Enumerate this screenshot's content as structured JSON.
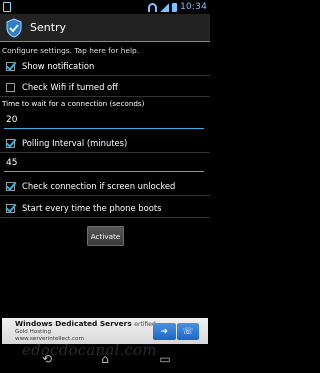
{
  "status_bar": {
    "time": "10:34"
  },
  "action_bar": {
    "title": "Sentry"
  },
  "hint": "Configure settings. Tap here for help.",
  "settings": {
    "show_notification": {
      "label": "Show notification",
      "checked": true
    },
    "check_wifi": {
      "label": "Check Wifi if turned off",
      "checked": false
    },
    "wait_label": "Time to wait for a connection (seconds)",
    "wait_value": "20",
    "polling": {
      "label": "Polling Interval (minutes)",
      "checked": true
    },
    "polling_value": "45",
    "check_unlocked": {
      "label": "Check connection if screen unlocked",
      "checked": true
    },
    "start_boot": {
      "label": "Start every time the phone boots",
      "checked": true
    }
  },
  "activate_label": "Activate",
  "ad": {
    "title": "Windows Dedicated Servers",
    "title_suffix": "ertified",
    "line2": "Gold Hosting",
    "line3": "www.serverintellect.com"
  },
  "watermark": "edocdocanal.com"
}
